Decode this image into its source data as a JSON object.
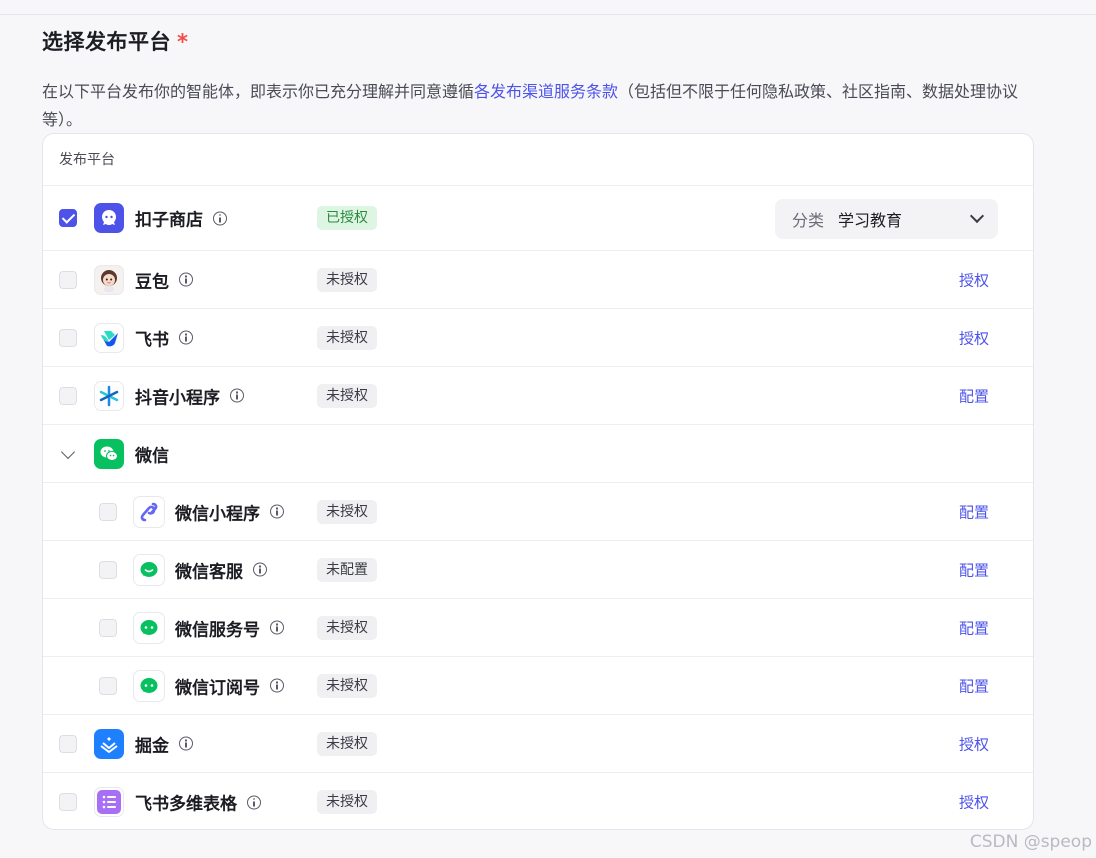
{
  "section": {
    "title": "选择发布平台",
    "required_mark": "*",
    "description_prefix": "在以下平台发布你的智能体，即表示你已充分理解并同意遵循",
    "terms_link": "各发布渠道服务条款",
    "description_suffix": "（包括但不限于任何隐私政策、社区指南、数据处理协议等）。"
  },
  "table": {
    "header": "发布平台",
    "rows": [
      {
        "name": "扣子商店",
        "status": "已授权",
        "checked": true,
        "category_label": "分类",
        "category_value": "学习教育",
        "icon": "coze-store-icon"
      },
      {
        "name": "豆包",
        "status": "未授权",
        "action": "授权",
        "icon": "doubao-icon"
      },
      {
        "name": "飞书",
        "status": "未授权",
        "action": "授权",
        "icon": "feishu-icon"
      },
      {
        "name": "抖音小程序",
        "status": "未授权",
        "action": "配置",
        "icon": "douyin-miniapp-icon"
      },
      {
        "name": "微信",
        "icon": "wechat-icon",
        "expanded": true
      },
      {
        "name": "微信小程序",
        "status": "未授权",
        "action": "配置",
        "icon": "wechat-miniapp-icon"
      },
      {
        "name": "微信客服",
        "status": "未配置",
        "action": "配置",
        "icon": "wechat-service-icon"
      },
      {
        "name": "微信服务号",
        "status": "未授权",
        "action": "配置",
        "icon": "wechat-service-account-icon"
      },
      {
        "name": "微信订阅号",
        "status": "未授权",
        "action": "配置",
        "icon": "wechat-subscription-icon"
      },
      {
        "name": "掘金",
        "status": "未授权",
        "action": "授权",
        "icon": "juejin-icon"
      },
      {
        "name": "飞书多维表格",
        "status": "未授权",
        "action": "授权",
        "icon": "feishu-bitable-icon"
      }
    ]
  },
  "watermark": "CSDN @speop",
  "colors": {
    "accent": "#4d53e8",
    "authorized_bg": "#dff5e3",
    "wechat_green": "#07c160"
  }
}
